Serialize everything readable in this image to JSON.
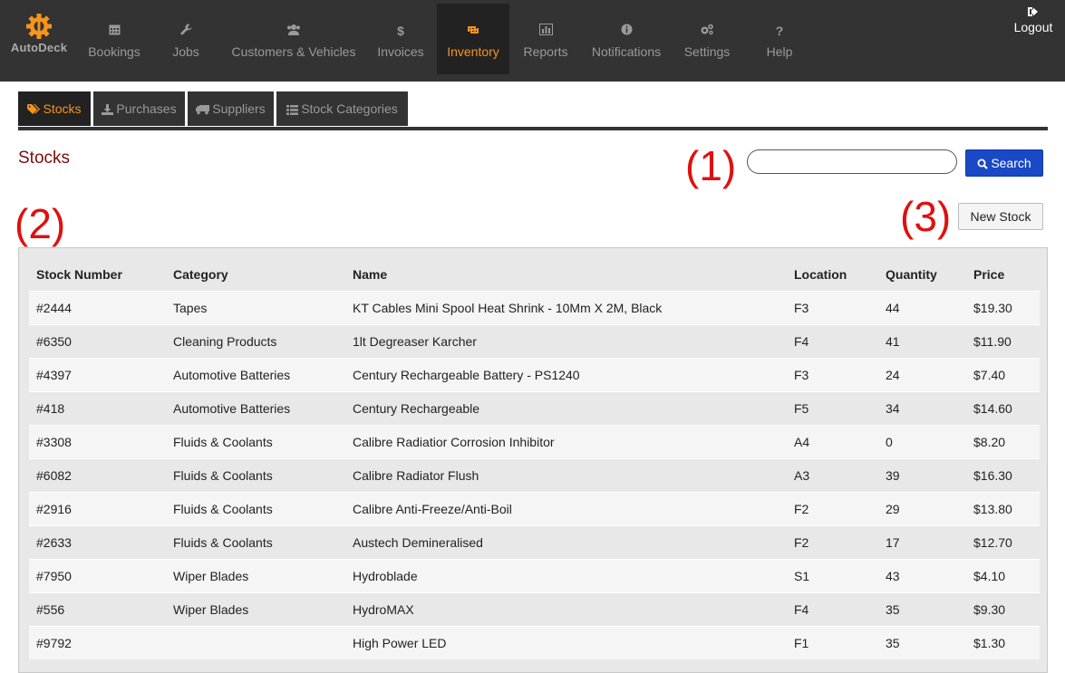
{
  "app": {
    "logo_text": "AutoDeck"
  },
  "nav": {
    "items": [
      {
        "label": "Bookings",
        "icon": "calendar-icon"
      },
      {
        "label": "Jobs",
        "icon": "wrench-icon"
      },
      {
        "label": "Customers & Vehicles",
        "icon": "users-icon"
      },
      {
        "label": "Invoices",
        "icon": "dollar-icon"
      },
      {
        "label": "Inventory",
        "icon": "retweet-icon",
        "active": true
      },
      {
        "label": "Reports",
        "icon": "bar-chart-icon"
      },
      {
        "label": "Notifications",
        "icon": "info-icon"
      },
      {
        "label": "Settings",
        "icon": "gears-icon"
      },
      {
        "label": "Help",
        "icon": "question-icon"
      }
    ],
    "logout_label": "Logout",
    "active_color": "#f7941d"
  },
  "subtabs": [
    {
      "label": "Stocks",
      "icon": "tags-icon",
      "active": true
    },
    {
      "label": "Purchases",
      "icon": "download-icon"
    },
    {
      "label": "Suppliers",
      "icon": "truck-icon"
    },
    {
      "label": "Stock Categories",
      "icon": "list-icon"
    }
  ],
  "page": {
    "title": "Stocks",
    "annotations": [
      "(1)",
      "(2)",
      "(3)"
    ],
    "search": {
      "value": "",
      "placeholder": "",
      "button_label": "Search"
    },
    "new_button_label": "New Stock"
  },
  "table": {
    "headers": [
      "Stock Number",
      "Category",
      "Name",
      "Location",
      "Quantity",
      "Price"
    ],
    "rows": [
      [
        "#2444",
        "Tapes",
        "KT Cables Mini Spool Heat Shrink - 10Mm X 2M, Black",
        "F3",
        "44",
        "$19.30"
      ],
      [
        "#6350",
        "Cleaning Products",
        "1lt Degreaser Karcher",
        "F4",
        "41",
        "$11.90"
      ],
      [
        "#4397",
        "Automotive Batteries",
        "Century Rechargeable Battery - PS1240",
        "F3",
        "24",
        "$7.40"
      ],
      [
        "#418",
        "Automotive Batteries",
        "Century Rechargeable",
        "F5",
        "34",
        "$14.60"
      ],
      [
        "#3308",
        "Fluids & Coolants",
        "Calibre Radiatior Corrosion Inhibitor",
        "A4",
        "0",
        "$8.20"
      ],
      [
        "#6082",
        "Fluids & Coolants",
        "Calibre Radiator Flush",
        "A3",
        "39",
        "$16.30"
      ],
      [
        "#2916",
        "Fluids & Coolants",
        "Calibre Anti-Freeze/Anti-Boil",
        "F2",
        "29",
        "$13.80"
      ],
      [
        "#2633",
        "Fluids & Coolants",
        "Austech Demineralised",
        "F2",
        "17",
        "$12.70"
      ],
      [
        "#7950",
        "Wiper Blades",
        "Hydroblade",
        "S1",
        "43",
        "$4.10"
      ],
      [
        "#556",
        "Wiper Blades",
        "HydroMAX",
        "F4",
        "35",
        "$9.30"
      ],
      [
        "#9792",
        "",
        "High Power LED",
        "F1",
        "35",
        "$1.30"
      ]
    ]
  }
}
